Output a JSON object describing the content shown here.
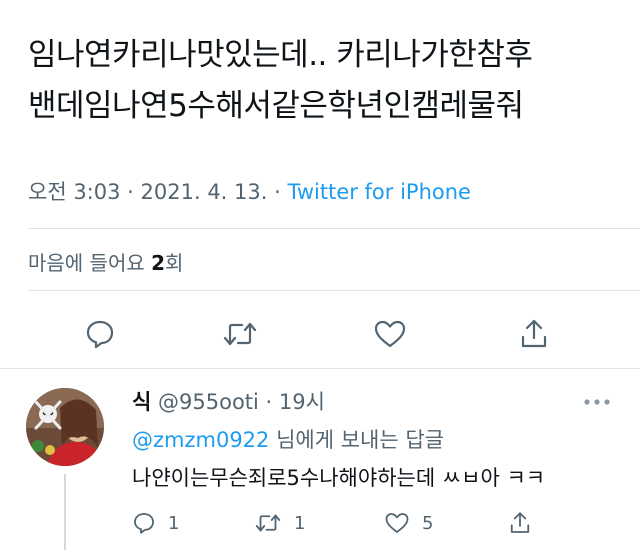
{
  "tweet": {
    "lines": [
      "임나연카리나맛있는데.. 카리나가한참후",
      "밴데임나연5수해서같은학년인캠레물줘"
    ],
    "time": "오전 3:03",
    "date": "2021. 4. 13.",
    "source": "Twitter for iPhone",
    "likes_label": "마음에 들어요",
    "likes_count": "2",
    "likes_suffix": "회",
    "actions": [
      "reply-icon",
      "retweet-icon",
      "like-icon",
      "share-icon"
    ]
  },
  "reply": {
    "name": "식",
    "handle": "@955ooti",
    "time": "19시",
    "replying_mention": "@zmzm0922",
    "replying_suffix": " 님에게 보내는 답글",
    "text": "나얀이는무슨죄로5수나해야하는데 ㅆㅂ아 ㅋㅋ",
    "reply_count": "1",
    "retweet_count": "1",
    "like_count": "5"
  },
  "colors": {
    "text": "#0f1419",
    "secondary": "#536471",
    "accent": "#1d9bf0",
    "divider": "#dfe3e8"
  }
}
